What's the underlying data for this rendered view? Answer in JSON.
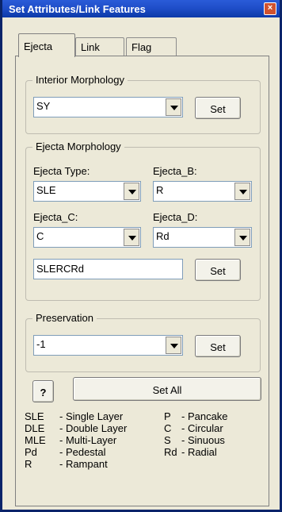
{
  "window": {
    "title": "Set Attributes/Link Features",
    "close_glyph": "×"
  },
  "tabs": [
    {
      "label": "Ejecta",
      "active": true
    },
    {
      "label": "Link",
      "active": false
    },
    {
      "label": "Flag",
      "active": false
    }
  ],
  "interior": {
    "legend": "Interior Morphology",
    "value": "SY",
    "set_label": "Set"
  },
  "ejecta": {
    "legend": "Ejecta Morphology",
    "type_label": "Ejecta Type:",
    "type_value": "SLE",
    "b_label": "Ejecta_B:",
    "b_value": "R",
    "c_label": "Ejecta_C:",
    "c_value": "C",
    "d_label": "Ejecta_D:",
    "d_value": "Rd",
    "combined_value": "SLERCRd",
    "set_label": "Set"
  },
  "preservation": {
    "legend": "Preservation",
    "value": "-1",
    "set_label": "Set"
  },
  "help_label": "?",
  "set_all_label": "Set All",
  "codes": {
    "left": [
      {
        "code": "SLE",
        "desc": "- Single Layer"
      },
      {
        "code": "DLE",
        "desc": "- Double Layer"
      },
      {
        "code": "MLE",
        "desc": "- Multi-Layer"
      },
      {
        "code": "Pd",
        "desc": "- Pedestal"
      },
      {
        "code": "R",
        "desc": "- Rampant"
      }
    ],
    "right": [
      {
        "code": "P",
        "desc": "- Pancake"
      },
      {
        "code": "C",
        "desc": "- Circular"
      },
      {
        "code": "S",
        "desc": "- Sinuous"
      },
      {
        "code": "Rd",
        "desc": "- Radial"
      }
    ]
  }
}
